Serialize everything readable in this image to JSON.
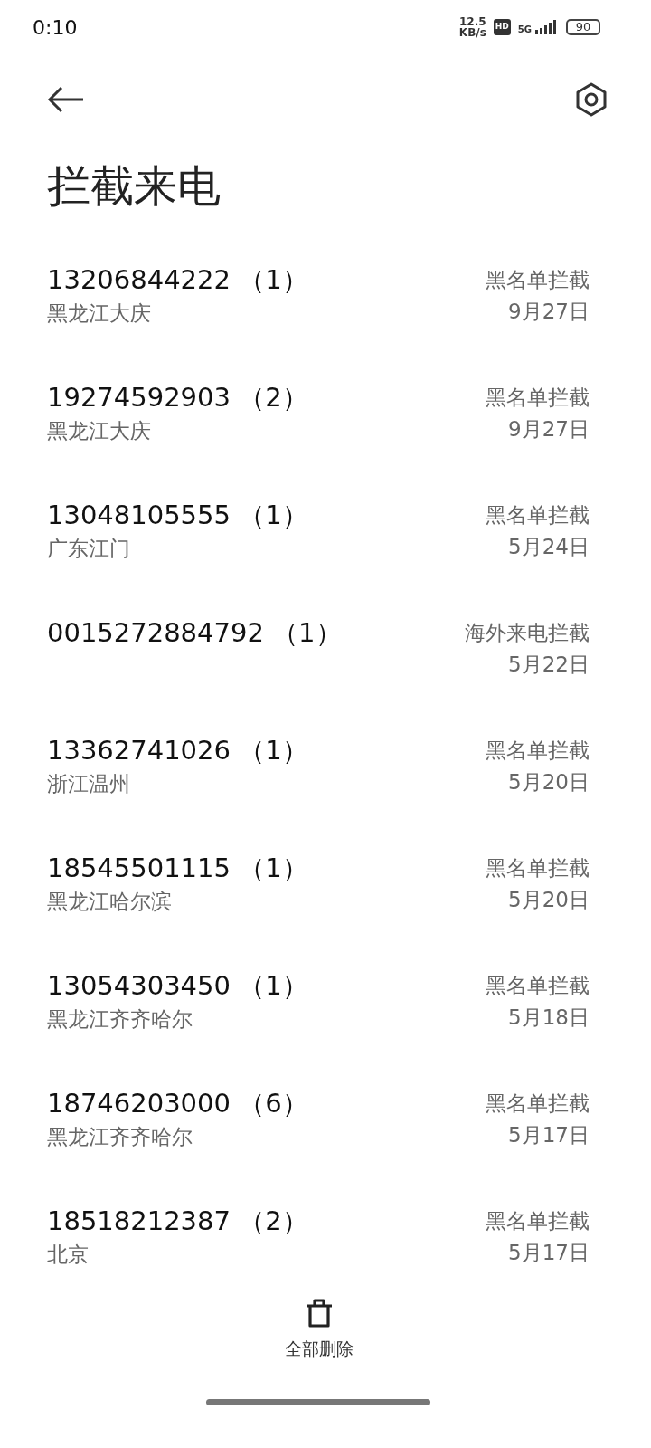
{
  "status_bar": {
    "time": "0:10",
    "speed_value": "12.5",
    "speed_unit": "KB/s",
    "hd": "HD",
    "network": "5G",
    "battery": "90"
  },
  "title": "拦截来电",
  "calls": [
    {
      "number": "13206844222",
      "count": "（1）",
      "location": "黑龙江大庆",
      "reason": "黑名单拦截",
      "date": "9月27日"
    },
    {
      "number": "19274592903",
      "count": "（2）",
      "location": "黑龙江大庆",
      "reason": "黑名单拦截",
      "date": "9月27日"
    },
    {
      "number": "13048105555",
      "count": "（1）",
      "location": "广东江门",
      "reason": "黑名单拦截",
      "date": "5月24日"
    },
    {
      "number": "0015272884792",
      "count": "（1）",
      "reason": "海外来电拦截",
      "date": "5月22日"
    },
    {
      "number": "13362741026",
      "count": "（1）",
      "location": "浙江温州",
      "reason": "黑名单拦截",
      "date": "5月20日"
    },
    {
      "number": "18545501115",
      "count": "（1）",
      "location": "黑龙江哈尔滨",
      "reason": "黑名单拦截",
      "date": "5月20日"
    },
    {
      "number": "13054303450",
      "count": "（1）",
      "location": "黑龙江齐齐哈尔",
      "reason": "黑名单拦截",
      "date": "5月18日"
    },
    {
      "number": "18746203000",
      "count": "（6）",
      "location": "黑龙江齐齐哈尔",
      "reason": "黑名单拦截",
      "date": "5月17日"
    },
    {
      "number": "18518212387",
      "count": "（2）",
      "location": "北京",
      "reason": "黑名单拦截",
      "date": "5月17日"
    }
  ],
  "bottom_action": {
    "label": "全部删除"
  }
}
